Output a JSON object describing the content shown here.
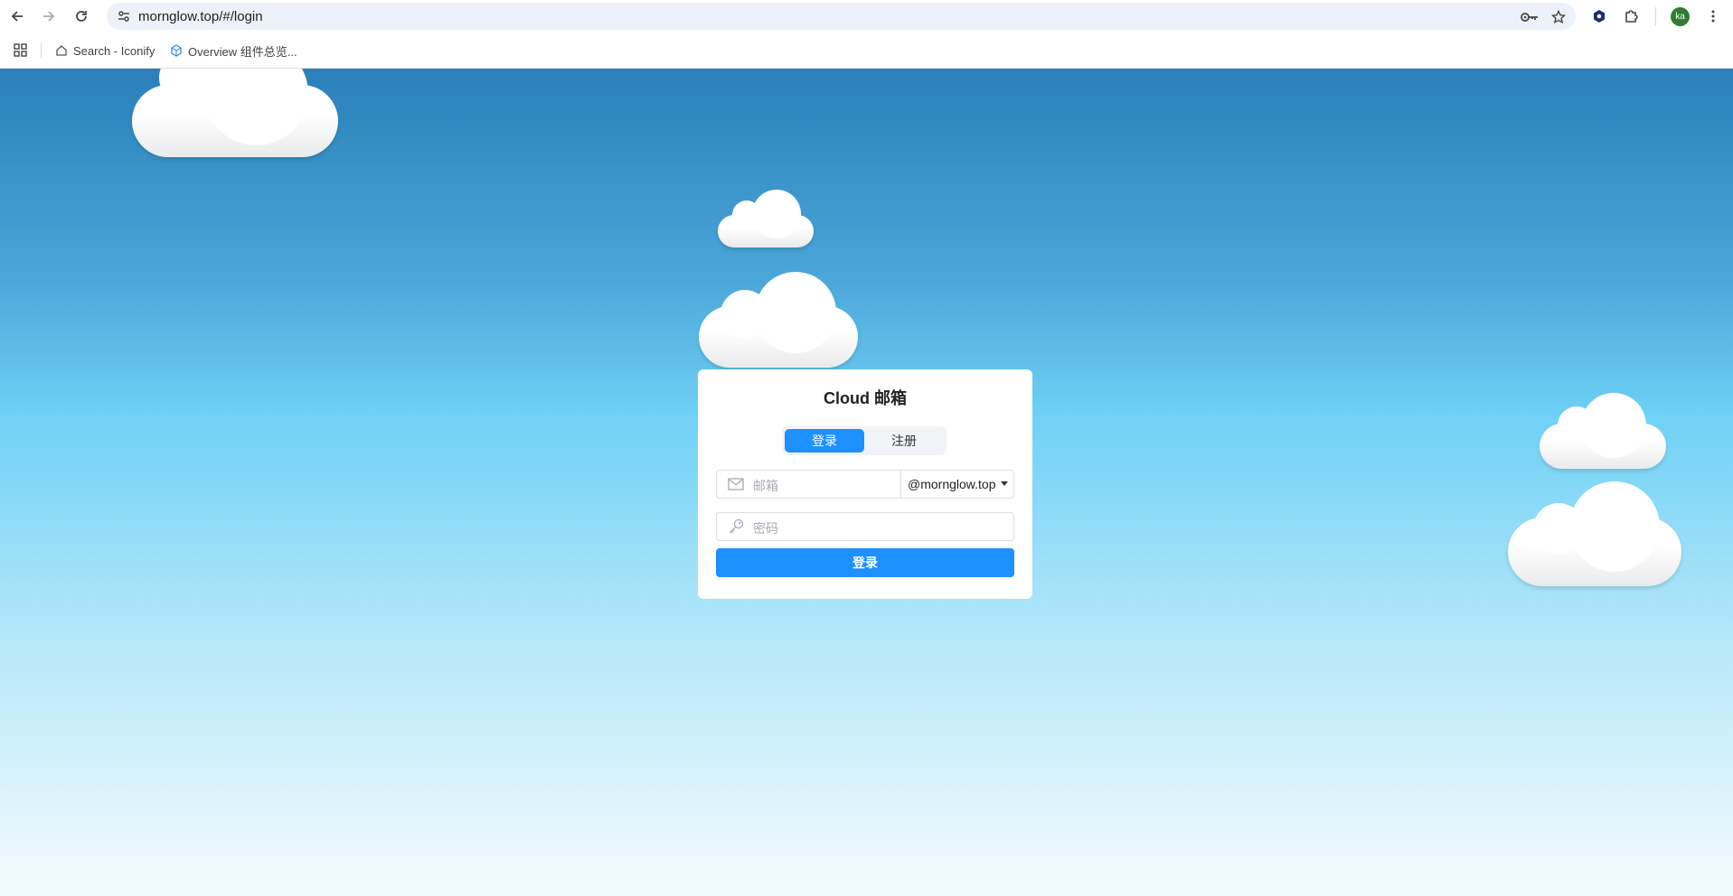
{
  "browser": {
    "url": "mornglow.top/#/login",
    "avatar_initials": "ka",
    "bookmarks": [
      {
        "label": "Search - Iconify",
        "icon": "home-icon"
      },
      {
        "label": "Overview 组件总览...",
        "icon": "component-cube-icon"
      }
    ]
  },
  "login": {
    "title": "Cloud 邮箱",
    "tabs": [
      {
        "label": "登录",
        "active": true
      },
      {
        "label": "注册",
        "active": false
      }
    ],
    "email_placeholder": "邮箱",
    "domain_value": "@mornglow.top",
    "password_placeholder": "密码",
    "submit_label": "登录"
  },
  "colors": {
    "accent": "#1e90ff",
    "sky_top": "#2a7fba",
    "sky_bottom": "#f4fbfe"
  }
}
